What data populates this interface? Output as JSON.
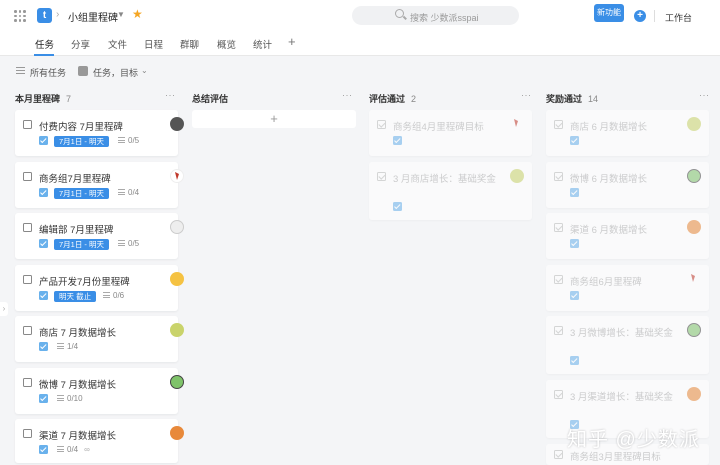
{
  "header": {
    "logo_letter": "t",
    "breadcrumb_sep": "›",
    "project_title": "小组里程碑",
    "search_placeholder": "搜索 少数派sspai",
    "new_feature": "新功能",
    "add": "+",
    "workbench": "工作台"
  },
  "tabs": [
    "任务",
    "分享",
    "文件",
    "日程",
    "群聊",
    "概览",
    "统计"
  ],
  "tab_add": "+",
  "filters": {
    "all_tasks": "所有任务",
    "view": "任务，目标"
  },
  "columns": [
    {
      "title": "本月里程碑",
      "count": "7"
    },
    {
      "title": "总结评估",
      "count": ""
    },
    {
      "title": "评估通过",
      "count": "2"
    },
    {
      "title": "奖励通过",
      "count": "14"
    }
  ],
  "more_label": "···",
  "add_card_label": "+",
  "col1_cards": [
    {
      "title": "付费内容 7月里程碑",
      "date": "7月1日 - 明天",
      "subtasks": "0/5",
      "extra": ""
    },
    {
      "title": "商务组7月里程碑",
      "date": "7月1日 - 明天",
      "subtasks": "0/4",
      "extra": ""
    },
    {
      "title": "编辑部 7月里程碑",
      "date": "7月1日 - 明天",
      "subtasks": "0/5",
      "extra": ""
    },
    {
      "title": "产品开发7月份里程碑",
      "date": "明天 截止",
      "subtasks": "0/6",
      "extra": ""
    },
    {
      "title": "商店 7 月数据增长",
      "date": "",
      "subtasks": "1/4",
      "extra": ""
    },
    {
      "title": "微博 7 月数据增长",
      "date": "",
      "subtasks": "0/10",
      "extra": ""
    },
    {
      "title": "渠道 7 月数据增长",
      "date": "",
      "subtasks": "0/4",
      "extra": "∞"
    }
  ],
  "col3_cards": [
    {
      "title": "商务组4月里程碑目标"
    },
    {
      "title": "3 月商店增长：基础奖金"
    }
  ],
  "col4_cards": [
    {
      "title": "商店 6 月数据增长"
    },
    {
      "title": "微博 6 月数据增长"
    },
    {
      "title": "渠道 6 月数据增长"
    },
    {
      "title": "商务组6月里程碑"
    },
    {
      "title": "3 月微博增长：基础奖金"
    },
    {
      "title": "3 月渠道增长：基础奖金"
    },
    {
      "title": "商务组3月里程碑目标"
    }
  ],
  "collapse_arrow": "›",
  "watermark": "知乎 @少数派",
  "colors": {
    "accent": "#3a8ee6",
    "star": "#f5a623"
  }
}
